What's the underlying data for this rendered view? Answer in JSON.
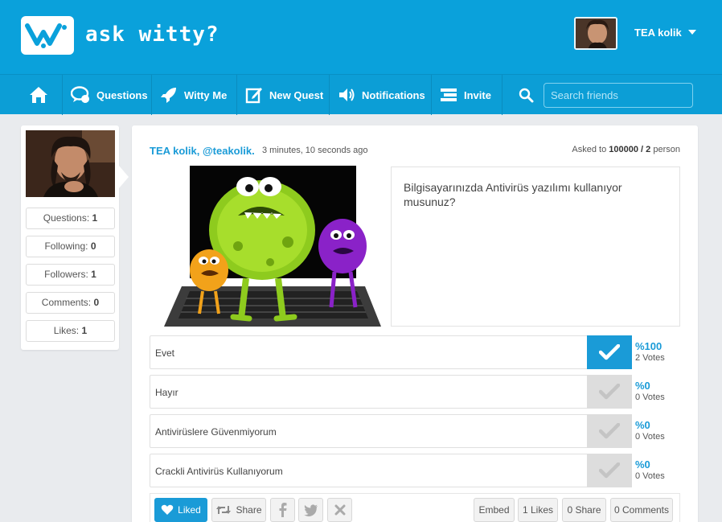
{
  "brand": {
    "name": "ask witty?",
    "accent_color": "#0aa1db",
    "logo_icon": "witty-logo-icon"
  },
  "user": {
    "name": "TEA kolik",
    "menu_icon": "caret-down-icon"
  },
  "nav": {
    "items": [
      {
        "label": "",
        "icon": "home-icon"
      },
      {
        "label": "Questions",
        "icon": "chat-bubble-icon"
      },
      {
        "label": "Witty Me",
        "icon": "rocket-icon"
      },
      {
        "label": "New Quest",
        "icon": "edit-icon"
      },
      {
        "label": "Notifications",
        "icon": "speaker-icon"
      },
      {
        "label": "Invite",
        "icon": "invite-icon"
      }
    ],
    "search": {
      "placeholder": "Search friends",
      "value": "",
      "icon": "search-icon"
    }
  },
  "profile": {
    "stats": [
      {
        "label": "Questions:",
        "value": "1"
      },
      {
        "label": "Following:",
        "value": "0"
      },
      {
        "label": "Followers:",
        "value": "1"
      },
      {
        "label": "Comments:",
        "value": "0"
      },
      {
        "label": "Likes:",
        "value": "1"
      }
    ]
  },
  "question": {
    "author": "TEA kolik, @teakolik.",
    "time": "3 minutes, 10 seconds ago",
    "asked_prefix": "Asked to",
    "asked_count": "100000 / 2",
    "asked_suffix": "person",
    "text": "Bilgisayarınızda Antivirüs yazılımı kullanıyor musunuz?",
    "answers": [
      {
        "label": "Evet",
        "percent": "%100",
        "votes": "2 Votes",
        "selected": true
      },
      {
        "label": "Hayır",
        "percent": "%0",
        "votes": "0 Votes",
        "selected": false
      },
      {
        "label": "Antivirüslere Güvenmiyorum",
        "percent": "%0",
        "votes": "0 Votes",
        "selected": false
      },
      {
        "label": "Crackli Antivirüs Kullanıyorum",
        "percent": "%0",
        "votes": "0 Votes",
        "selected": false
      }
    ]
  },
  "actions": {
    "liked": "Liked",
    "share": "Share",
    "embed": "Embed",
    "likes_count": "1 Likes",
    "share_count": "0 Share",
    "comments_count": "0 Comments"
  }
}
